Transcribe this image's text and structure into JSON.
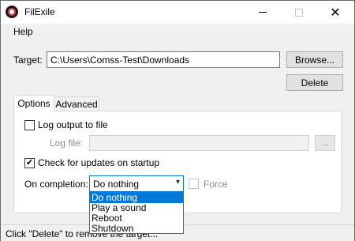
{
  "window": {
    "title": "FilExile"
  },
  "menu": {
    "help": "Help"
  },
  "target": {
    "label": "Target:",
    "value": "C:\\Users\\Comss-Test\\Downloads"
  },
  "buttons": {
    "browse": "Browse...",
    "delete": "Delete"
  },
  "tabs": [
    {
      "label": "Options"
    },
    {
      "label": "Advanced"
    }
  ],
  "options": {
    "log_output": {
      "label": "Log output to file",
      "checked": false
    },
    "log_file": {
      "label": "Log file:",
      "browse": "..."
    },
    "check_updates": {
      "label": "Check for updates on startup",
      "checked": true
    },
    "on_completion": {
      "label": "On completion:",
      "selected": "Do nothing",
      "options": [
        "Do nothing",
        "Play a sound",
        "Reboot",
        "Shutdown"
      ]
    },
    "force": {
      "label": "Force",
      "checked": false
    }
  },
  "status": {
    "text": "Click \"Delete\" to remove the target..."
  },
  "colors": {
    "accent": "#0078d7"
  }
}
